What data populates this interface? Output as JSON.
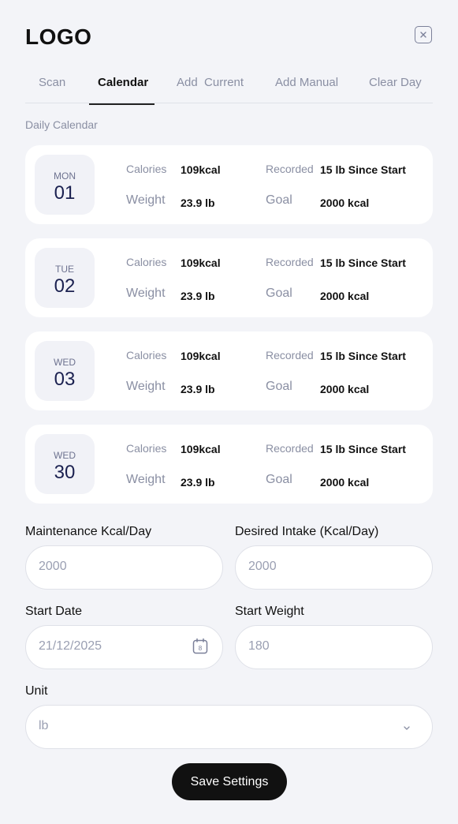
{
  "header": {
    "logo": "LOGO"
  },
  "tabs": [
    {
      "label": "Scan"
    },
    {
      "label": "Calendar"
    },
    {
      "label": "Add  Current"
    },
    {
      "label": "Add Manual"
    },
    {
      "label": "Clear Day"
    }
  ],
  "active_tab": "Calendar",
  "calendar": {
    "title": "Daily Calendar",
    "labels": {
      "calories": "Calories",
      "weight": "Weight",
      "recorded": "Recorded",
      "goal": "Goal"
    },
    "days": [
      {
        "dow": "MON",
        "num": "01",
        "calories": "109kcal",
        "weight": "23.9 lb",
        "recorded": "15 lb Since Start",
        "goal": "2000 kcal"
      },
      {
        "dow": "TUE",
        "num": "02",
        "calories": "109kcal",
        "weight": "23.9 lb",
        "recorded": "15 lb Since Start",
        "goal": "2000 kcal"
      },
      {
        "dow": "WED",
        "num": "03",
        "calories": "109kcal",
        "weight": "23.9 lb",
        "recorded": "15 lb Since Start",
        "goal": "2000 kcal"
      },
      {
        "dow": "WED",
        "num": "30",
        "calories": "109kcal",
        "weight": "23.9 lb",
        "recorded": "15 lb Since Start",
        "goal": "2000 kcal"
      }
    ]
  },
  "settings": {
    "maintenance": {
      "label": "Maintenance Kcal/Day",
      "placeholder": "2000"
    },
    "desired": {
      "label": "Desired Intake (Kcal/Day)",
      "placeholder": "2000"
    },
    "start_date": {
      "label": "Start Date",
      "value": "21/12/2025",
      "calendar_day": "8"
    },
    "start_weight": {
      "label": "Start Weight",
      "placeholder": "180"
    },
    "unit": {
      "label": "Unit",
      "value": "lb"
    },
    "save_label": "Save Settings"
  }
}
